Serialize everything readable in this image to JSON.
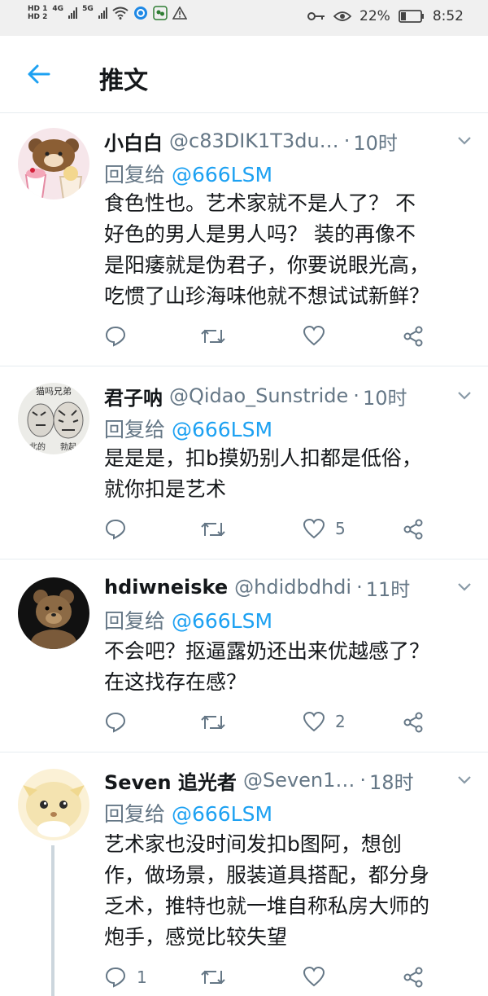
{
  "status_bar": {
    "hd1": "HD",
    "sub1": "1",
    "hd2": "HD",
    "sub2": "2",
    "net1": "4G",
    "net2": "5G",
    "battery": "22%",
    "time": "8:52"
  },
  "header": {
    "title": "推文"
  },
  "colors": {
    "accent": "#1da1f2",
    "muted": "#657786",
    "text": "#14171a"
  },
  "tweets": [
    {
      "name": "小白白",
      "handle": "@c83DIK1T3du…",
      "dot": "·",
      "time": "10时",
      "reply_prefix": "回复给",
      "reply_to": "@666LSM",
      "lines": [
        "食色性也。艺术家就不是人了？ 不",
        "好色的男人是男人吗？ 装的再像不",
        "是阳痿就是伪君子，你要说眼光高，",
        "吃惯了山珍海味他就不想试试新鲜？"
      ],
      "replies": "",
      "likes": ""
    },
    {
      "name": "君子呐",
      "handle": "@Qidao_Sunstride",
      "dot": "·",
      "time": "10时",
      "reply_prefix": "回复给",
      "reply_to": "@666LSM",
      "lines": [
        "是是是，扣b摸奶别人扣都是低俗，",
        "就你扣是艺术"
      ],
      "replies": "",
      "likes": "5",
      "avatar_text_top": "猫吗兄弟",
      "avatar_text_bottom_left": "北的",
      "avatar_text_bottom_right": "勃起"
    },
    {
      "name": "hdiwneiske",
      "handle": "@hdidbdhdi",
      "dot": "·",
      "time": "11时",
      "reply_prefix": "回复给",
      "reply_to": "@666LSM",
      "lines": [
        "不会吧？抠逼露奶还出来优越感了？",
        "在这找存在感？"
      ],
      "replies": "",
      "likes": "2"
    },
    {
      "name": "Seven 追光者",
      "handle": "@Seven1…",
      "dot": "·",
      "time": "18时",
      "reply_prefix": "回复给",
      "reply_to": "@666LSM",
      "lines": [
        "艺术家也没时间发扣b图阿，想创",
        "作，做场景，服装道具搭配，都分身",
        "乏术，推特也就一堆自称私房大师的",
        "炮手，感觉比较失望"
      ],
      "replies": "1",
      "likes": ""
    }
  ]
}
